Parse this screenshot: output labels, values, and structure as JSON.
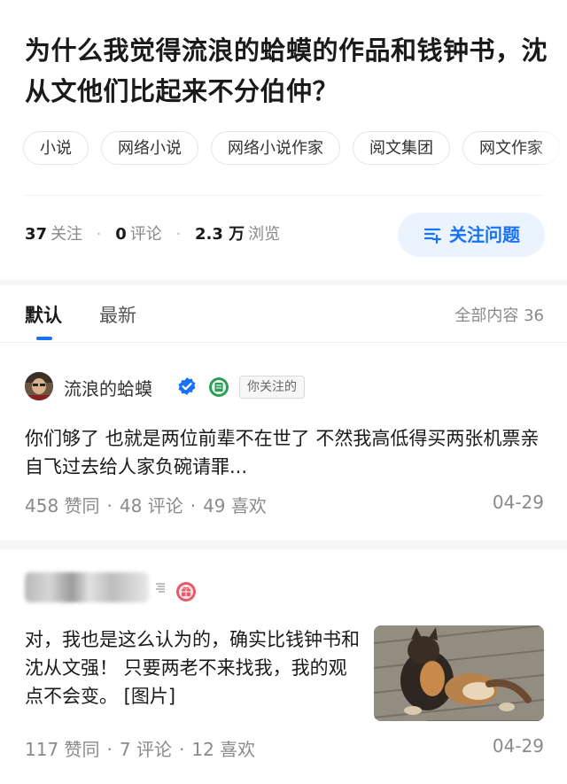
{
  "question": {
    "title": "为什么我觉得流浪的蛤蟆的作品和钱钟书，沈从文他们比起来不分伯仲？",
    "tags": [
      "小说",
      "网络小说",
      "网络小说作家",
      "阅文集团",
      "网文作家"
    ],
    "stats": {
      "followers": "37",
      "followers_label": "关注",
      "comments": "0",
      "comments_label": "评论",
      "views": "2.3 万",
      "views_label": "浏览"
    },
    "follow_button": "关注问题"
  },
  "tabs": {
    "default": "默认",
    "latest": "最新",
    "all_count": "全部内容 36"
  },
  "answers": [
    {
      "author": "流浪的蛤蟆",
      "followed_tag": "你关注的",
      "text": "你们够了 也就是两位前辈不在世了 不然我高低得买两张机票亲自飞过去给人家负碗请罪...",
      "upvotes": "458 赞同",
      "comments": "48 评论",
      "likes": "49 喜欢",
      "date": "04-29"
    },
    {
      "author": "",
      "text": "对，我也是这么认为的，确实比钱钟书和沈从文强！ 只要两老不来找我，我的观点不会变。 [图片]",
      "upvotes": "117 赞同",
      "comments": "7 评论",
      "likes": "12 喜欢",
      "date": "04-29"
    }
  ],
  "colors": {
    "accent": "#1772f6",
    "accent_bg": "#ebf3ff",
    "verified": "#1772f6"
  },
  "icons": [
    "follow-question-icon",
    "verified-icon",
    "book-badge-icon",
    "gift-badge-icon",
    "mini-mark-icon"
  ]
}
